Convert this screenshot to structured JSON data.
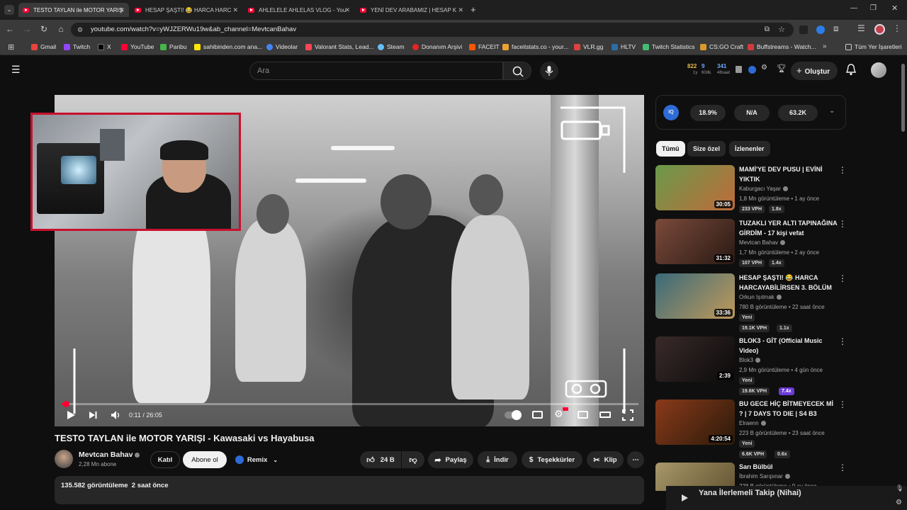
{
  "tabs": [
    {
      "label": "TESTO TAYLAN ile MOTOR YARIŞ",
      "active": true
    },
    {
      "label": "HESAP ŞAŞTI! 😂 HARCA HARC",
      "active": false
    },
    {
      "label": "AHLELELE AHLELAS VLOG - You",
      "active": false
    },
    {
      "label": "YENİ DEV ARABAMIZ | HESAP K",
      "active": false
    }
  ],
  "address": {
    "url": "youtube.com/watch?v=yWJZERWu19w&ab_channel=MevtcanBahav"
  },
  "bookmarks": [
    {
      "label": "Gmail",
      "color": "#e8453c"
    },
    {
      "label": "Twitch",
      "color": "#9146ff"
    },
    {
      "label": "X",
      "color": "#000000"
    },
    {
      "label": "YouTube",
      "color": "#ff0033"
    },
    {
      "label": "Paribu",
      "color": "#45b649"
    },
    {
      "label": "sahibinden.com ana...",
      "color": "#ffe800"
    },
    {
      "label": "Videolar",
      "color": "#4285f4"
    },
    {
      "label": "Valorant Stats, Lead...",
      "color": "#ff4655"
    },
    {
      "label": "Steam",
      "color": "#1b2838"
    },
    {
      "label": "Donanım Arşivi",
      "color": "#e52521"
    },
    {
      "label": "FACEIT",
      "color": "#ff5500"
    },
    {
      "label": "faceitstats.co - your...",
      "color": "#f0a030"
    },
    {
      "label": "VLR.gg",
      "color": "#e04040"
    },
    {
      "label": "HLTV",
      "color": "#2b6ea6"
    },
    {
      "label": "Twitch Statistics",
      "color": "#3fbf6f"
    },
    {
      "label": "CS:GO Craft",
      "color": "#d89b2b"
    },
    {
      "label": "Buffstreams - Watch...",
      "color": "#d23a3a"
    },
    {
      "label": "Tüm Yer İşaretleri",
      "color": "#c0c0c0"
    }
  ],
  "youtube": {
    "search_placeholder": "Ara",
    "create_label": "Oluştur",
    "stats_widget": {
      "v1": "822",
      "v2": "9",
      "v3": "341",
      "s1": "1y",
      "s2": "60dk.",
      "s3": "48saat"
    }
  },
  "player": {
    "time_current": "0:11",
    "time_separator": "/",
    "time_total": "26:05",
    "progress": 0.007
  },
  "video": {
    "title": "TESTO TAYLAN ile MOTOR YARIŞI - Kawasaki vs Hayabusa",
    "channel": "Mevtcan Bahav",
    "subscribers": "2,28 Mn abone",
    "join_label": "Katıl",
    "subscribe_label": "Abone ol",
    "remix_label": "Remix",
    "likes": "24 B",
    "share_label": "Paylaş",
    "download_label": "İndir",
    "thanks_label": "Teşekkürler",
    "clip_label": "Klip",
    "views": "135.582 görüntüleme",
    "uploaded": "2 saat önce"
  },
  "extension": {
    "stat1": "18.9%",
    "stat2": "N/A",
    "stat3": "63.2K",
    "logo": "IQ"
  },
  "chips": [
    "Tümü",
    "Size özel",
    "İzlenenler"
  ],
  "recommendations": [
    {
      "title": "MAMİ'YE DEV PUSU | EVİNİ YIKTIK",
      "channel": "Kaburgacı Yaşar",
      "meta": "1,8 Mn görüntüleme • 1 ay önce",
      "duration": "30:05",
      "new": "",
      "vph": "233 VPH",
      "mult": "1.8x",
      "thumb": "#4a7a3a"
    },
    {
      "title": "TUZAKLI YER ALTI TAPINAĞINA GİRDİM - 17 kişi vefat",
      "channel": "Mevtcan Bahav",
      "meta": "1,7 Mn görüntüleme • 2 ay önce",
      "duration": "31:32",
      "new": "",
      "vph": "107 VPH",
      "mult": "1.4x",
      "thumb": "#5a3a2a"
    },
    {
      "title": "HESAP ŞAŞTI! 😂 HARCA HARCAYABİLİRSEN 3. BÖLÜM",
      "channel": "Orkun Işıtmak",
      "meta": "780 B görüntüleme • 22 saat önce",
      "duration": "33:36",
      "new": "Yeni",
      "vph": "19.1K VPH",
      "mult": "1.1x",
      "thumb": "#3a5a6a"
    },
    {
      "title": "BLOK3 - GİT (Official Music Video)",
      "channel": "Blok3",
      "meta": "2,9 Mn görüntüleme • 4 gün önce",
      "duration": "2:39",
      "new": "Yeni",
      "vph": "19.6K VPH",
      "mult": "7.4x",
      "thumb": "#2a1a1a"
    },
    {
      "title": "BU GECE HİÇ BİTMEYECEK Mİ ? | 7 DAYS TO DIE | S4 B3",
      "channel": "Elraenn",
      "meta": "223 B görüntüleme • 23 saat önce",
      "duration": "4:20:54",
      "new": "Yeni",
      "vph": "6.6K VPH",
      "mult": "0.6x",
      "thumb": "#6a2a1a"
    },
    {
      "title": "Sarı Bülbül",
      "channel": "İbrahim Sarıpınar",
      "meta": "228 B görüntüleme • 9 ay önce",
      "duration": "",
      "new": "",
      "vph": "",
      "mult": "",
      "thumb": "#8a7a5a"
    }
  ],
  "miniplayer": {
    "title": "Yana İlerlemeli Takip (Nihai)"
  }
}
